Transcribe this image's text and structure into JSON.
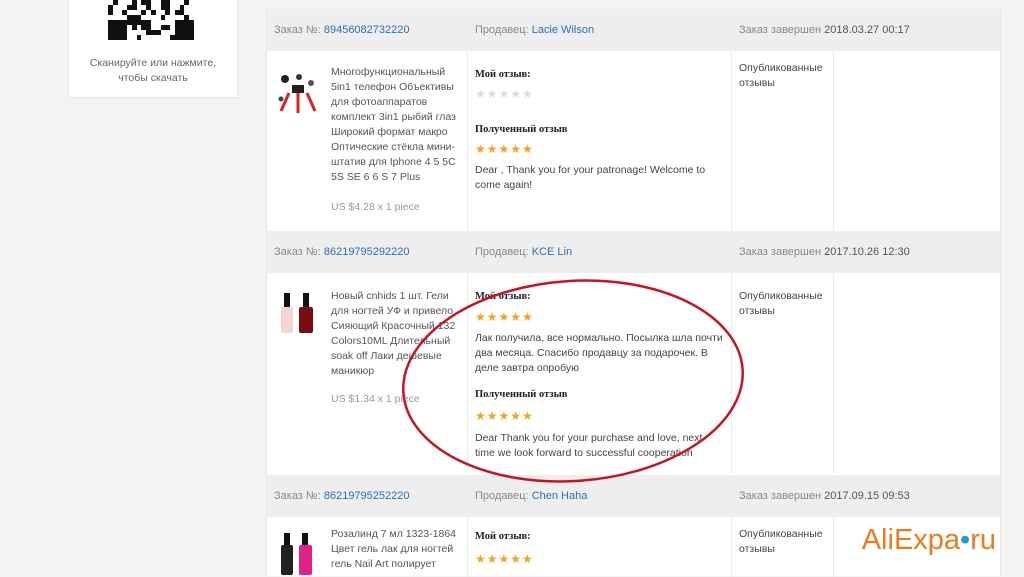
{
  "sidebar": {
    "qr_caption_line1": "Сканируйте или нажмите,",
    "qr_caption_line2": "чтобы скачать"
  },
  "labels": {
    "order_label": "Заказ №:",
    "seller_label": "Продавец:",
    "completed_label": "Заказ завершен",
    "my_review": "Мой отзыв:",
    "received_review": "Полученный отзыв"
  },
  "orders": [
    {
      "number": "89456082732220",
      "seller": "Lacie Wilson",
      "completed": "2018.03.27 00:17",
      "product": "Многофункциональный 5in1 телефон Объективы для фотоаппаратов комплект 3in1 рыбий глаз Широкий формат макро Оптические стёкла мини-штатив для Iphone 4 5 5C 5S SE 6 6 S 7 Plus",
      "price": "US $4.28 x 1 piece",
      "my_stars": "★★★★★",
      "my_text": "",
      "received_stars": "★★★★★",
      "received_text": "Dear , Thank you for your patronage! Welcome to come again!",
      "status": "Опубликованные отзывы"
    },
    {
      "number": "86219795292220",
      "seller": "KCE Lin",
      "completed": "2017.10.26 12:30",
      "product": "Новый cnhids 1 шт. Гели для ногтей УФ и привело Сияющий Красочный 132 Colors10ML Длительный soak off Лаки дешевые маникюр",
      "price": "US $1.34 x 1 piece",
      "my_stars": "★★★★★",
      "my_text": "Лак получила, все нормально. Посылка шла почти два месяца. Спасибо продавцу за подарочек. В деле завтра опробую",
      "received_stars": "★★★★★",
      "received_text": "Dear Thank you for your purchase and love, next time we look forward to successful cooperation",
      "status": "Опубликованные отзывы"
    },
    {
      "number": "86219795252220",
      "seller": "Chen Haha",
      "completed": "2017.09.15 09:53",
      "product": "Розалинд 7 мл 1323-1864 Цвет гель лак для ногтей гель Nail Art полирует",
      "my_stars": "★★★★★",
      "status": "Опубликованные отзывы"
    }
  ],
  "watermark": {
    "main": "AliExpa",
    "dot": "•",
    "tld": "ru"
  }
}
